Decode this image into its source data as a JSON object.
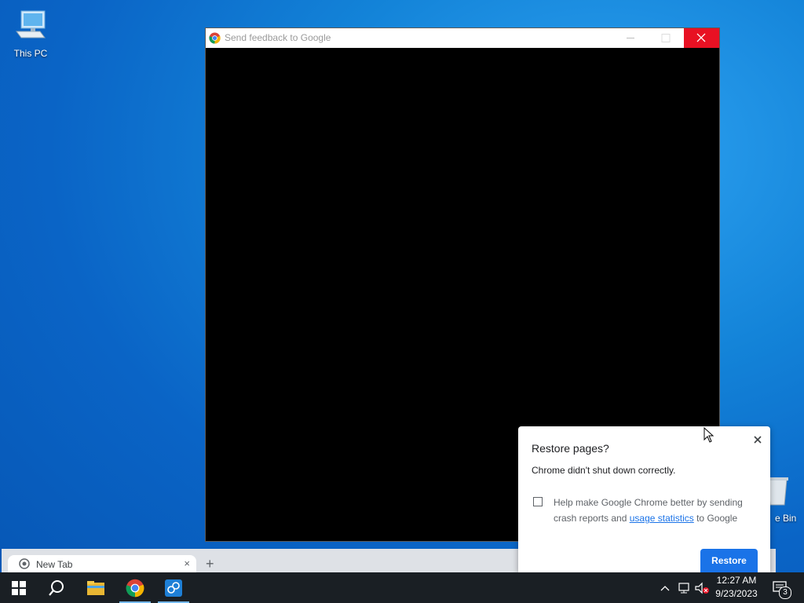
{
  "desktop": {
    "icons": [
      {
        "label": "This PC",
        "icon": "computer-icon"
      },
      {
        "label": "e Bin",
        "icon": "recycle-bin-icon"
      }
    ]
  },
  "feedback_window": {
    "title": "Send feedback to Google",
    "controls": [
      "minimize-icon",
      "maximize-icon",
      "close-icon"
    ],
    "close_color": "#e81123"
  },
  "chrome_window": {
    "tab_label": "New Tab",
    "new_tab_symbol": "+",
    "close_symbol": "×"
  },
  "restore_dialog": {
    "title": "Restore pages?",
    "message": "Chrome didn't shut down correctly.",
    "checkbox_checked": false,
    "help_text_before": "Help make Google Chrome better by sending crash reports and ",
    "help_link": "usage statistics",
    "help_text_after": " to Google",
    "restore_button": "Restore",
    "accent": "#1a73e8"
  },
  "taskbar": {
    "pinned": [
      "start-icon",
      "search-icon",
      "file-explorer-icon",
      "chrome-icon",
      "network-app-icon"
    ],
    "time": "12:27 AM",
    "date": "9/23/2023",
    "notification_count": "3"
  }
}
